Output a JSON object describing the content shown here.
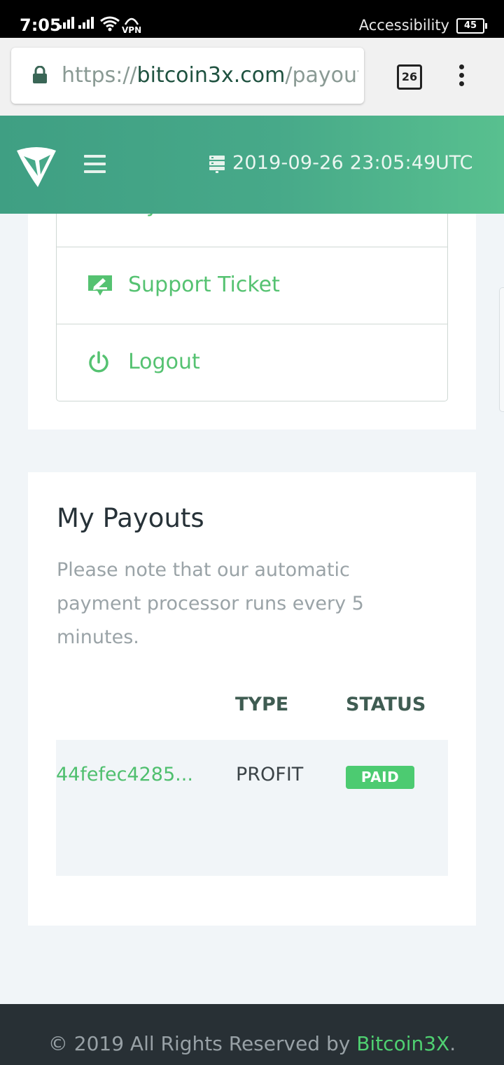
{
  "status_bar": {
    "time": "7:05",
    "vpn_label": "VPN",
    "accessibility_label": "Accessibility",
    "battery_level": "45"
  },
  "browser": {
    "url_scheme": "https://",
    "url_host": "bitcoin3x.com",
    "url_path": "/payout",
    "tab_count": "26"
  },
  "header": {
    "datetime": "2019-09-26 23:05:49",
    "timezone": "UTC"
  },
  "menu": {
    "partial_item_label": "My Referrals",
    "items": [
      {
        "label": "Support Ticket",
        "icon": "support-ticket-icon"
      },
      {
        "label": "Logout",
        "icon": "power-icon"
      }
    ]
  },
  "payouts": {
    "title": "My Payouts",
    "note": "Please note that our automatic payment processor runs every 5 minutes.",
    "columns": [
      "",
      "TYPE",
      "STATUS"
    ],
    "rows": [
      {
        "id": "44fefec4285...",
        "type": "PROFIT",
        "status": "PAID"
      }
    ]
  },
  "footer": {
    "copyright_prefix": "© 2019 All Rights Reserved by ",
    "brand": "Bitcoin3X",
    "suffix": "."
  },
  "colors": {
    "accent_green": "#55c271",
    "header_gradient_start": "#3f9f83",
    "header_gradient_end": "#58c08f",
    "badge_paid": "#4ccb71",
    "footer_bg": "#283035"
  }
}
